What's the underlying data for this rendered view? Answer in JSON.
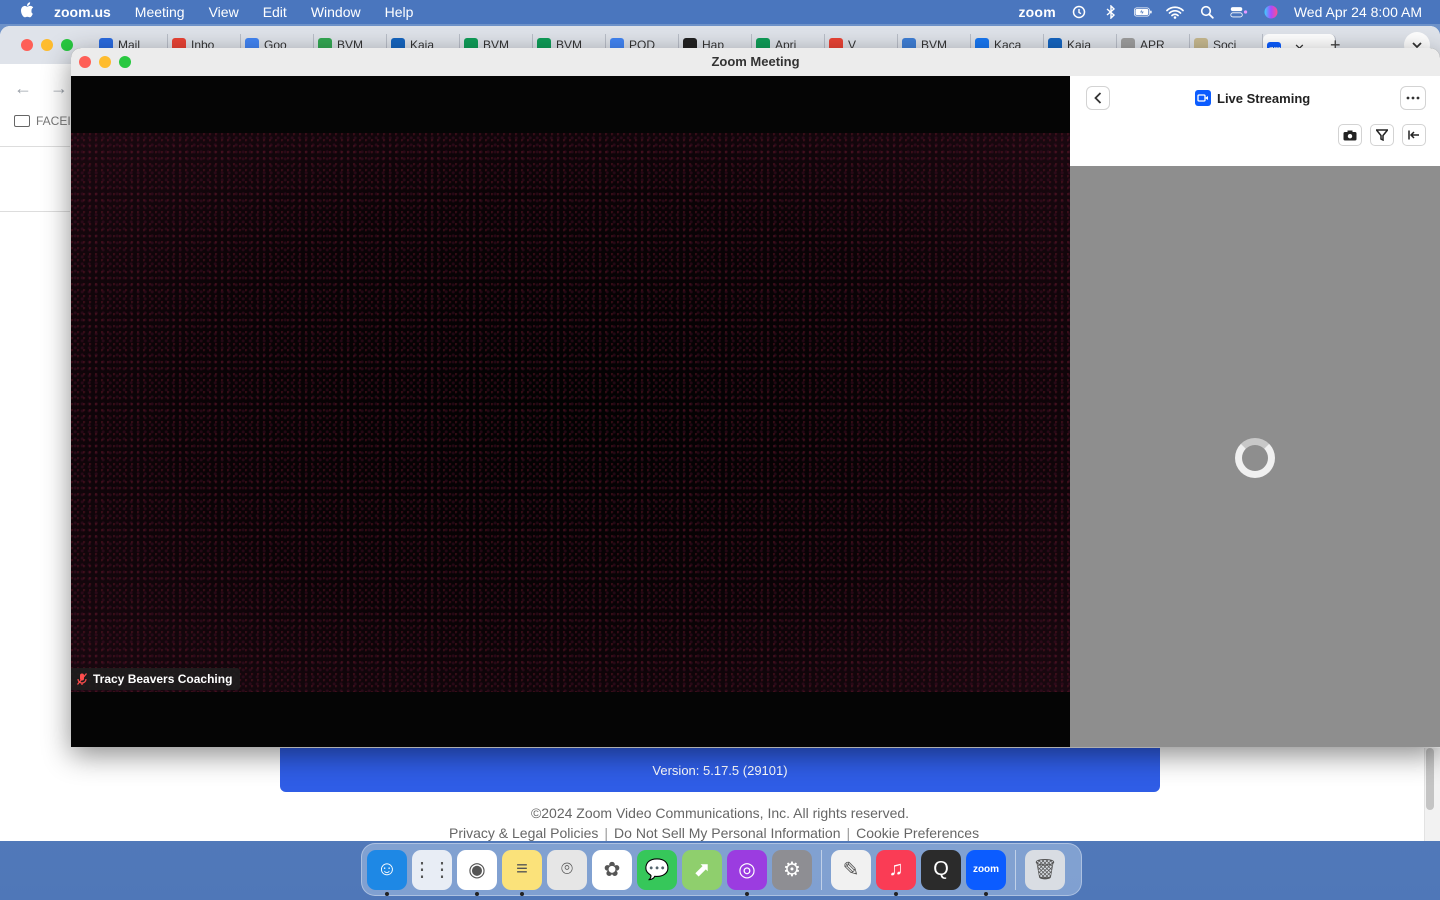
{
  "menubar": {
    "app": "zoom.us",
    "items": [
      "Meeting",
      "View",
      "Edit",
      "Window",
      "Help"
    ],
    "zoom_word": "zoom",
    "datetime": "Wed Apr 24  8:00 AM"
  },
  "browser": {
    "tabs": [
      {
        "label": "Mail",
        "color": "#2a6be0"
      },
      {
        "label": "Inbo",
        "color": "#ea4335"
      },
      {
        "label": "Goo",
        "color": "#4285f4"
      },
      {
        "label": "BVM",
        "color": "#34a853"
      },
      {
        "label": "Kaja",
        "color": "#1565c0"
      },
      {
        "label": "BVM",
        "color": "#0f9d58"
      },
      {
        "label": "BVM",
        "color": "#0f9d58"
      },
      {
        "label": "POD",
        "color": "#4285f4"
      },
      {
        "label": "Hap",
        "color": "#222222"
      },
      {
        "label": "Apri",
        "color": "#0f9d58"
      },
      {
        "label": "V",
        "color": "#ea4335"
      },
      {
        "label": "BVM",
        "color": "#3f7fd6"
      },
      {
        "label": "Kaca",
        "color": "#1877f2"
      },
      {
        "label": "Kaja",
        "color": "#1565c0"
      },
      {
        "label": "APR",
        "color": "#9e9e9e"
      },
      {
        "label": "Soci",
        "color": "#c7b98f"
      },
      {
        "label": "zm",
        "color": "#0b5cff"
      }
    ],
    "bookmark_label": "FACEI",
    "version_text": "Version: 5.17.5 (29101)",
    "copyright": "©2024 Zoom Video Communications, Inc. All rights reserved.",
    "footer_links": [
      "Privacy & Legal Policies",
      "Do Not Sell My Personal Information",
      "Cookie Preferences"
    ]
  },
  "zoom": {
    "window_title": "Zoom Meeting",
    "participant_name": "Tracy Beavers Coaching",
    "panel_title": "Live Streaming",
    "more_label": "···",
    "back_label": "‹"
  },
  "dock": {
    "apps": [
      {
        "name": "finder-icon",
        "color": "#1e88e5",
        "glyph": "☺",
        "running": true
      },
      {
        "name": "launchpad-icon",
        "color": "#e8edf5",
        "glyph": "⋮⋮",
        "running": false
      },
      {
        "name": "chrome-icon",
        "color": "#ffffff",
        "glyph": "◉",
        "running": true
      },
      {
        "name": "notes-icon",
        "color": "#fbe27a",
        "glyph": "≡",
        "running": true
      },
      {
        "name": "screenshot-icon",
        "color": "#e6e6e6",
        "glyph": "⌾",
        "running": false
      },
      {
        "name": "photos-icon",
        "color": "#ffffff",
        "glyph": "✿",
        "running": false
      },
      {
        "name": "messages-icon",
        "color": "#36c75a",
        "glyph": "💬",
        "running": false
      },
      {
        "name": "maps-icon",
        "color": "#8fcf6d",
        "glyph": "⬈",
        "running": false
      },
      {
        "name": "podcasts-icon",
        "color": "#9b3ce0",
        "glyph": "◎",
        "running": true
      },
      {
        "name": "system-settings-icon",
        "color": "#8e8e93",
        "glyph": "⚙",
        "running": false
      },
      {
        "name": "textedit-icon",
        "color": "#f1f1f1",
        "glyph": "✎",
        "running": false
      },
      {
        "name": "music-icon",
        "color": "#fa3c55",
        "glyph": "♫",
        "running": true
      },
      {
        "name": "quicktime-icon",
        "color": "#2b2b2b",
        "glyph": "Q",
        "running": false
      },
      {
        "name": "zoom-icon",
        "color": "#0b5cff",
        "glyph": "zoom",
        "running": true
      },
      {
        "name": "trash-icon",
        "color": "#d9dde3",
        "glyph": "🗑",
        "running": false
      }
    ]
  }
}
